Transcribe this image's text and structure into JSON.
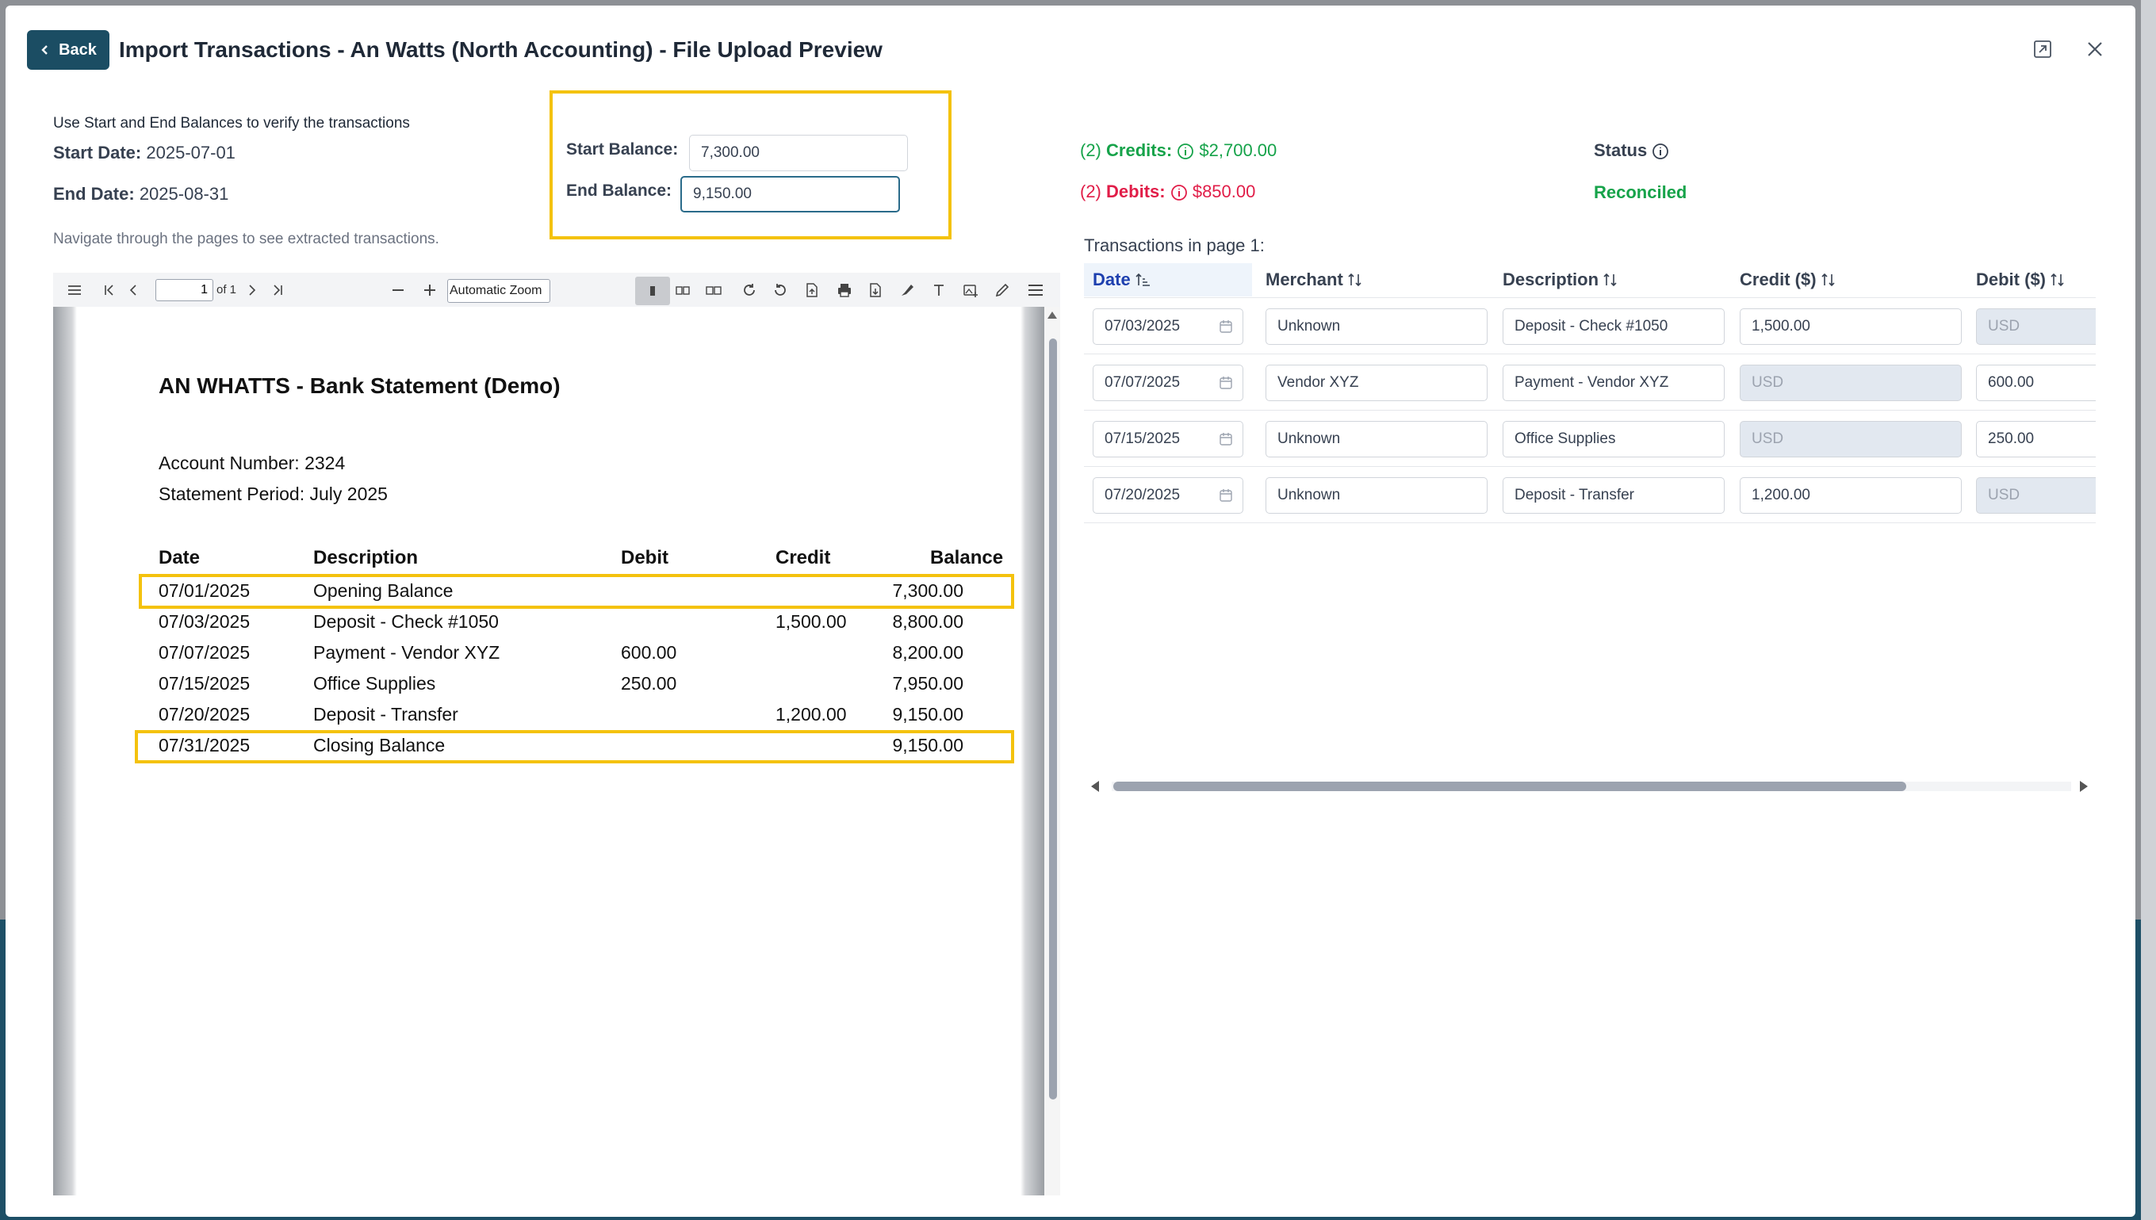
{
  "header": {
    "back_label": "Back",
    "title": "Import Transactions - An Watts (North Accounting) - File Upload Preview"
  },
  "info": {
    "hint": "Use Start and End Balances to verify the transactions",
    "start_date_label": "Start Date:",
    "start_date": "2025-07-01",
    "end_date_label": "End Date:",
    "end_date": "2025-08-31",
    "navigate_hint": "Navigate through the pages to see extracted transactions."
  },
  "balances": {
    "start_label": "Start Balance:",
    "start_value": "7,300.00",
    "end_label": "End Balance:",
    "end_value": "9,150.00"
  },
  "summary": {
    "credits_count": "(2)",
    "credits_label": "Credits:",
    "credits_amount": "$2,700.00",
    "debits_count": "(2)",
    "debits_label": "Debits:",
    "debits_amount": "$850.00",
    "status_label": "Status",
    "status_value": "Reconciled",
    "credit_color": "#16a34a",
    "debit_color": "#e11d48"
  },
  "pdf_viewer": {
    "page_value": "1",
    "page_of": "of 1",
    "zoom": "Automatic Zoom",
    "document": {
      "title": "AN WHATTS - Bank Statement (Demo)",
      "account": "Account Number: 2324",
      "period": "Statement Period: July 2025",
      "headers": [
        "Date",
        "Description",
        "Debit",
        "Credit",
        "Balance"
      ],
      "rows": [
        {
          "date": "07/01/2025",
          "desc": "Opening Balance",
          "debit": "",
          "credit": "",
          "balance": "7,300.00"
        },
        {
          "date": "07/03/2025",
          "desc": "Deposit - Check #1050",
          "debit": "",
          "credit": "1,500.00",
          "balance": "8,800.00"
        },
        {
          "date": "07/07/2025",
          "desc": "Payment - Vendor XYZ",
          "debit": "600.00",
          "credit": "",
          "balance": "8,200.00"
        },
        {
          "date": "07/15/2025",
          "desc": "Office Supplies",
          "debit": "250.00",
          "credit": "",
          "balance": "7,950.00"
        },
        {
          "date": "07/20/2025",
          "desc": "Deposit - Transfer",
          "debit": "",
          "credit": "1,200.00",
          "balance": "9,150.00"
        },
        {
          "date": "07/31/2025",
          "desc": "Closing Balance",
          "debit": "",
          "credit": "",
          "balance": "9,150.00"
        }
      ]
    }
  },
  "transactions": {
    "caption": "Transactions in page 1:",
    "columns": [
      "Date",
      "Merchant",
      "Description",
      "Credit ($)",
      "Debit ($)"
    ],
    "rows": [
      {
        "date": "07/03/2025",
        "merchant": "Unknown",
        "description": "Deposit - Check #1050",
        "credit": "1,500.00",
        "debit": "USD"
      },
      {
        "date": "07/07/2025",
        "merchant": "Vendor XYZ",
        "description": "Payment - Vendor XYZ",
        "credit": "USD",
        "debit": "600.00"
      },
      {
        "date": "07/15/2025",
        "merchant": "Unknown",
        "description": "Office Supplies",
        "credit": "USD",
        "debit": "250.00"
      },
      {
        "date": "07/20/2025",
        "merchant": "Unknown",
        "description": "Deposit - Transfer",
        "credit": "1,200.00",
        "debit": "USD"
      }
    ]
  }
}
